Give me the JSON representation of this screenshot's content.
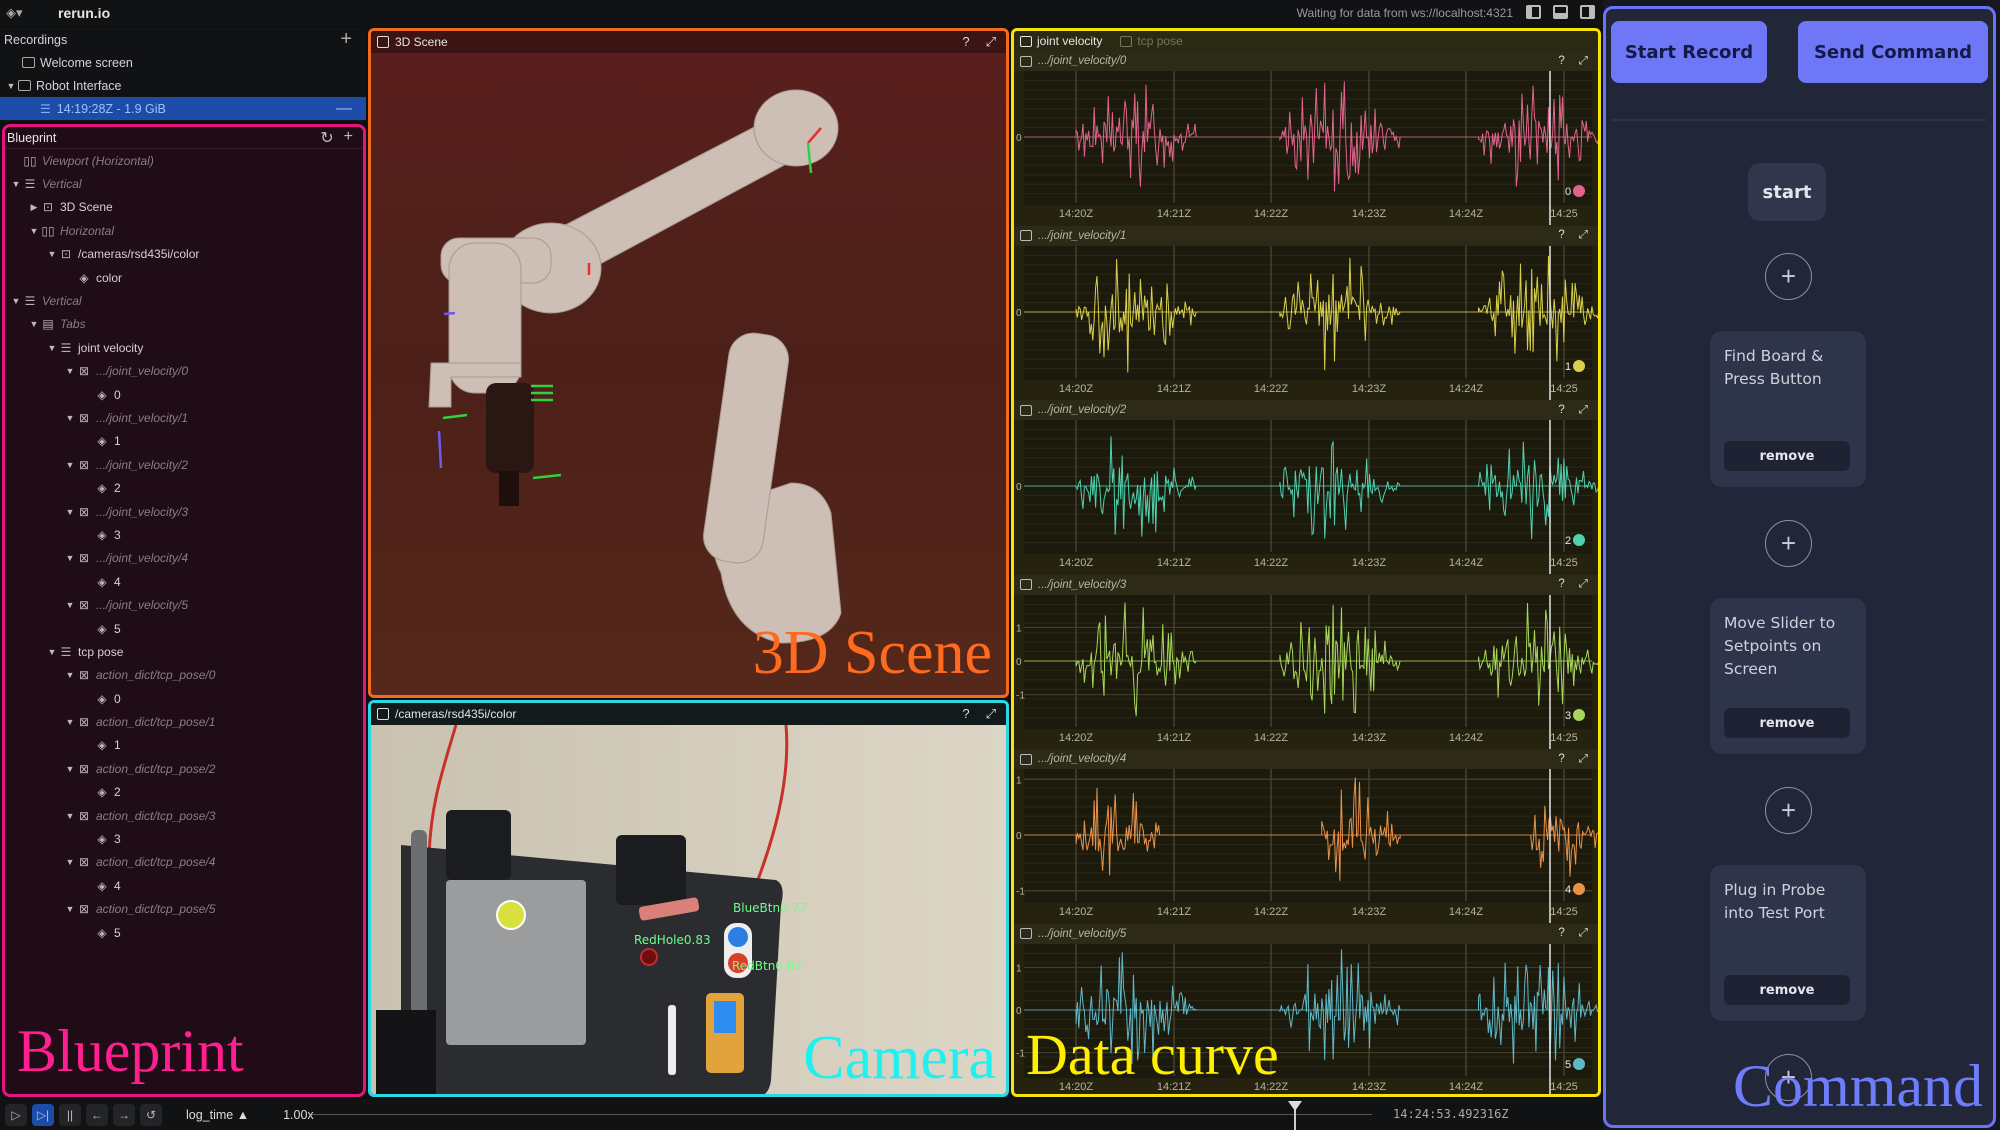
{
  "topbar": {
    "app_name": "rerun.io",
    "status": "Waiting for data from ws://localhost:4321"
  },
  "recordings": {
    "title": "Recordings",
    "items": [
      {
        "label": "Welcome screen"
      },
      {
        "label": "Robot Interface"
      },
      {
        "label": "14:19:28Z - 1.9 GiB"
      }
    ]
  },
  "blueprint": {
    "title": "Blueprint",
    "annotation": "Blueprint",
    "tree": [
      {
        "label": "Viewport (Horizontal)",
        "indent": 0,
        "italic": true,
        "expander": "",
        "icon": "horizontal-icon"
      },
      {
        "label": "Vertical",
        "indent": 0,
        "italic": true,
        "expander": "down",
        "icon": "vertical-icon"
      },
      {
        "label": "3D Scene",
        "indent": 1,
        "italic": false,
        "expander": "right",
        "icon": "scene-icon"
      },
      {
        "label": "Horizontal",
        "indent": 1,
        "italic": true,
        "expander": "down",
        "icon": "horizontal-icon"
      },
      {
        "label": "/cameras/rsd435i/color",
        "indent": 2,
        "italic": false,
        "expander": "down",
        "icon": "image-icon"
      },
      {
        "label": "color",
        "indent": 3,
        "italic": false,
        "expander": "",
        "icon": "entity-icon"
      },
      {
        "label": "Vertical",
        "indent": 0,
        "italic": true,
        "expander": "down",
        "icon": "vertical-icon"
      },
      {
        "label": "Tabs",
        "indent": 1,
        "italic": true,
        "expander": "down",
        "icon": "tabs-icon"
      },
      {
        "label": "joint velocity",
        "indent": 2,
        "italic": false,
        "expander": "down",
        "icon": "vertical-icon"
      },
      {
        "label": ".../joint_velocity/0",
        "indent": 3,
        "italic": true,
        "expander": "down",
        "icon": "timeseries-icon"
      },
      {
        "label": "0",
        "indent": 4,
        "italic": false,
        "expander": "",
        "icon": "entity-icon"
      },
      {
        "label": ".../joint_velocity/1",
        "indent": 3,
        "italic": true,
        "expander": "down",
        "icon": "timeseries-icon"
      },
      {
        "label": "1",
        "indent": 4,
        "italic": false,
        "expander": "",
        "icon": "entity-icon"
      },
      {
        "label": ".../joint_velocity/2",
        "indent": 3,
        "italic": true,
        "expander": "down",
        "icon": "timeseries-icon"
      },
      {
        "label": "2",
        "indent": 4,
        "italic": false,
        "expander": "",
        "icon": "entity-icon"
      },
      {
        "label": ".../joint_velocity/3",
        "indent": 3,
        "italic": true,
        "expander": "down",
        "icon": "timeseries-icon"
      },
      {
        "label": "3",
        "indent": 4,
        "italic": false,
        "expander": "",
        "icon": "entity-icon"
      },
      {
        "label": ".../joint_velocity/4",
        "indent": 3,
        "italic": true,
        "expander": "down",
        "icon": "timeseries-icon"
      },
      {
        "label": "4",
        "indent": 4,
        "italic": false,
        "expander": "",
        "icon": "entity-icon"
      },
      {
        "label": ".../joint_velocity/5",
        "indent": 3,
        "italic": true,
        "expander": "down",
        "icon": "timeseries-icon"
      },
      {
        "label": "5",
        "indent": 4,
        "italic": false,
        "expander": "",
        "icon": "entity-icon"
      },
      {
        "label": "tcp pose",
        "indent": 2,
        "italic": false,
        "expander": "down",
        "icon": "vertical-icon"
      },
      {
        "label": "action_dict/tcp_pose/0",
        "indent": 3,
        "italic": true,
        "expander": "down",
        "icon": "timeseries-icon"
      },
      {
        "label": "0",
        "indent": 4,
        "italic": false,
        "expander": "",
        "icon": "entity-icon"
      },
      {
        "label": "action_dict/tcp_pose/1",
        "indent": 3,
        "italic": true,
        "expander": "down",
        "icon": "timeseries-icon"
      },
      {
        "label": "1",
        "indent": 4,
        "italic": false,
        "expander": "",
        "icon": "entity-icon"
      },
      {
        "label": "action_dict/tcp_pose/2",
        "indent": 3,
        "italic": true,
        "expander": "down",
        "icon": "timeseries-icon"
      },
      {
        "label": "2",
        "indent": 4,
        "italic": false,
        "expander": "",
        "icon": "entity-icon"
      },
      {
        "label": "action_dict/tcp_pose/3",
        "indent": 3,
        "italic": true,
        "expander": "down",
        "icon": "timeseries-icon"
      },
      {
        "label": "3",
        "indent": 4,
        "italic": false,
        "expander": "",
        "icon": "entity-icon"
      },
      {
        "label": "action_dict/tcp_pose/4",
        "indent": 3,
        "italic": true,
        "expander": "down",
        "icon": "timeseries-icon"
      },
      {
        "label": "4",
        "indent": 4,
        "italic": false,
        "expander": "",
        "icon": "entity-icon"
      },
      {
        "label": "action_dict/tcp_pose/5",
        "indent": 3,
        "italic": true,
        "expander": "down",
        "icon": "timeseries-icon"
      },
      {
        "label": "5",
        "indent": 4,
        "italic": false,
        "expander": "",
        "icon": "entity-icon"
      }
    ]
  },
  "scene": {
    "title": "3D Scene",
    "annotation": "3D Scene",
    "help": "?"
  },
  "camera": {
    "title": "/cameras/rsd435i/color",
    "annotation": "Camera",
    "help": "?",
    "detections": [
      {
        "label": "BlueBtn0.77"
      },
      {
        "label": "RedHole0.83"
      },
      {
        "label": "RedBtn0.82"
      }
    ]
  },
  "curves": {
    "annotation": "Data curve",
    "tabs": [
      {
        "label": "joint velocity",
        "active": true
      },
      {
        "label": "tcp pose",
        "active": false
      }
    ],
    "help": "?"
  },
  "chart_data": [
    {
      "type": "line",
      "title": ".../joint_velocity/0",
      "series": [
        {
          "name": "0",
          "color": "#e0648f"
        }
      ],
      "x_ticks": [
        "14:20Z",
        "14:21Z",
        "14:22Z",
        "14:23Z",
        "14:24Z",
        "14:25"
      ],
      "y_ticks": [
        "0"
      ],
      "ylim": [
        -1,
        1
      ],
      "bursts": [
        [
          14.33,
          14.56
        ],
        [
          14.72,
          14.95
        ],
        [
          15.1,
          15.33
        ]
      ],
      "amplitude": 0.9,
      "grid": true
    },
    {
      "type": "line",
      "title": ".../joint_velocity/1",
      "series": [
        {
          "name": "1",
          "color": "#d8d04c"
        }
      ],
      "x_ticks": [
        "14:20Z",
        "14:21Z",
        "14:22Z",
        "14:23Z",
        "14:24Z",
        "14:25"
      ],
      "y_ticks": [
        "0"
      ],
      "ylim": [
        -1,
        1
      ],
      "bursts": [
        [
          14.33,
          14.56
        ],
        [
          14.72,
          14.95
        ],
        [
          15.1,
          15.33
        ]
      ],
      "amplitude": 0.95,
      "grid": true
    },
    {
      "type": "line",
      "title": ".../joint_velocity/2",
      "series": [
        {
          "name": "2",
          "color": "#4fd1b0"
        }
      ],
      "x_ticks": [
        "14:20Z",
        "14:21Z",
        "14:22Z",
        "14:23Z",
        "14:24Z",
        "14:25"
      ],
      "y_ticks": [
        "0"
      ],
      "ylim": [
        -1,
        1
      ],
      "bursts": [
        [
          14.33,
          14.56
        ],
        [
          14.72,
          14.95
        ],
        [
          15.1,
          15.33
        ]
      ],
      "amplitude": 0.9,
      "grid": true
    },
    {
      "type": "line",
      "title": ".../joint_velocity/3",
      "series": [
        {
          "name": "3",
          "color": "#a6d75a"
        }
      ],
      "x_ticks": [
        "14:20Z",
        "14:21Z",
        "14:22Z",
        "14:23Z",
        "14:24Z",
        "14:25"
      ],
      "y_ticks": [
        "1",
        "0",
        "-1"
      ],
      "ylim": [
        -1.9,
        1.9
      ],
      "bursts": [
        [
          14.33,
          14.56
        ],
        [
          14.72,
          14.95
        ],
        [
          15.1,
          15.33
        ]
      ],
      "amplitude": 1.8,
      "grid": true
    },
    {
      "type": "line",
      "title": ".../joint_velocity/4",
      "series": [
        {
          "name": "4",
          "color": "#e8924a"
        }
      ],
      "x_ticks": [
        "14:20Z",
        "14:21Z",
        "14:22Z",
        "14:23Z",
        "14:24Z",
        "14:25"
      ],
      "y_ticks": [
        "1",
        "0",
        "-1"
      ],
      "ylim": [
        -1.15,
        1.15
      ],
      "bursts": [
        [
          14.33,
          14.49
        ],
        [
          14.8,
          14.95
        ],
        [
          15.2,
          15.33
        ]
      ],
      "amplitude": 1.05,
      "grid": true
    },
    {
      "type": "line",
      "title": ".../joint_velocity/5",
      "series": [
        {
          "name": "5",
          "color": "#5fb8c8"
        }
      ],
      "x_ticks": [
        "14:20Z",
        "14:21Z",
        "14:22Z",
        "14:23Z",
        "14:24Z",
        "14:25"
      ],
      "y_ticks": [
        "1",
        "0",
        "-1"
      ],
      "ylim": [
        -1.5,
        1.5
      ],
      "bursts": [
        [
          14.33,
          14.56
        ],
        [
          14.72,
          14.95
        ],
        [
          15.1,
          15.33
        ]
      ],
      "amplitude": 1.5,
      "grid": true
    }
  ],
  "command": {
    "start_record": "Start Record",
    "send_command": "Send Command",
    "start_node": "start",
    "add_symbol": "+",
    "tasks": [
      {
        "title": "Find Board & Press Button",
        "remove": "remove"
      },
      {
        "title": "Move Slider to Setpoints on Screen",
        "remove": "remove"
      },
      {
        "title": "Plug in Probe into Test Port",
        "remove": "remove"
      }
    ],
    "annotation": "Command",
    "accent": "#6e78f6"
  },
  "timeline": {
    "mode": "log_time ▲",
    "speed": "1.00x",
    "time": "14:24:53.492316Z",
    "progress": 0.926
  }
}
